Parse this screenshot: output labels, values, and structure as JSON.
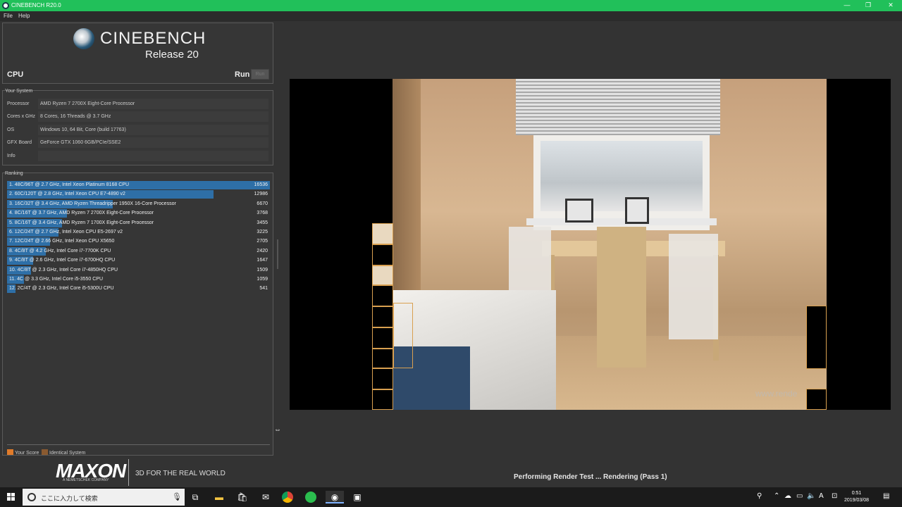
{
  "window": {
    "title": "CINEBENCH R20.0",
    "controls": {
      "minimize": "—",
      "restore": "❐",
      "close": "✕"
    }
  },
  "menu": {
    "items": [
      "File",
      "Help"
    ]
  },
  "header": {
    "logo_text": "CINEBENCH",
    "release": "Release 20",
    "cpu_label": "CPU",
    "run_label": "Run",
    "run_button": "Run"
  },
  "system": {
    "section_title": "Your System",
    "rows": [
      {
        "label": "Processor",
        "value": "AMD Ryzen 7 2700X Eight-Core Processor"
      },
      {
        "label": "Cores x GHz",
        "value": "8 Cores, 16 Threads @ 3.7 GHz"
      },
      {
        "label": "OS",
        "value": "Windows 10, 64 Bit, Core (build 17763)"
      },
      {
        "label": "GFX Board",
        "value": "GeForce GTX 1060 6GB/PCIe/SSE2"
      },
      {
        "label": "Info",
        "value": ""
      }
    ]
  },
  "ranking": {
    "section_title": "Ranking",
    "max_score": 16536,
    "accent": "#2e6fa7",
    "entries": [
      {
        "label": "1. 48C/96T @ 2.7 GHz, Intel Xeon Platinum 8168 CPU",
        "score": 16536
      },
      {
        "label": "2. 60C/120T @ 2.8 GHz, Intel Xeon CPU E7-4890 v2",
        "score": 12986
      },
      {
        "label": "3. 16C/32T @ 3.4 GHz, AMD Ryzen Threadripper 1950X 16-Core Processor",
        "score": 6670
      },
      {
        "label": "4. 8C/16T @ 3.7 GHz, AMD Ryzen 7 2700X Eight-Core Processor",
        "score": 3768
      },
      {
        "label": "5. 8C/16T @ 3.4 GHz, AMD Ryzen 7 1700X Eight-Core Processor",
        "score": 3455
      },
      {
        "label": "6. 12C/24T @ 2.7 GHz, Intel Xeon CPU E5-2697 v2",
        "score": 3225
      },
      {
        "label": "7. 12C/24T @ 2.66 GHz, Intel Xeon CPU X5650",
        "score": 2705
      },
      {
        "label": "8. 4C/8T @ 4.2 GHz, Intel Core i7-7700K CPU",
        "score": 2420
      },
      {
        "label": "9. 4C/8T @ 2.6 GHz, Intel Core i7-6700HQ CPU",
        "score": 1647
      },
      {
        "label": "10. 4C/8T @ 2.3 GHz, Intel Core i7-4850HQ CPU",
        "score": 1509
      },
      {
        "label": "11. 4C @ 3.3 GHz, Intel Core i5-3550 CPU",
        "score": 1059
      },
      {
        "label": "12. 2C/4T @ 2.3 GHz, Intel Core i5-5300U CPU",
        "score": 541
      }
    ],
    "legend": [
      {
        "label": "Your Score",
        "color": "#e07b2a"
      },
      {
        "label": "Identical System",
        "color": "#8a5a30"
      }
    ]
  },
  "footer": {
    "brand": "MAXON",
    "brand_sub": "A NEMETSCHEK COMPANY",
    "slogan": "3D FOR THE REAL WORLD"
  },
  "render": {
    "watermark": "www.rende",
    "status": "Performing Render Test ... Rendering (Pass 1)"
  },
  "taskbar": {
    "search_placeholder": "ここに入力して検索",
    "icons": [
      "windows-start-icon",
      "task-view-icon",
      "file-explorer-icon",
      "store-icon",
      "mail-icon",
      "chrome-icon",
      "green-app-icon",
      "cinebench-icon",
      "app-icon"
    ],
    "tray": {
      "ime": "A",
      "time": "0:51",
      "date": "2019/03/08"
    }
  }
}
